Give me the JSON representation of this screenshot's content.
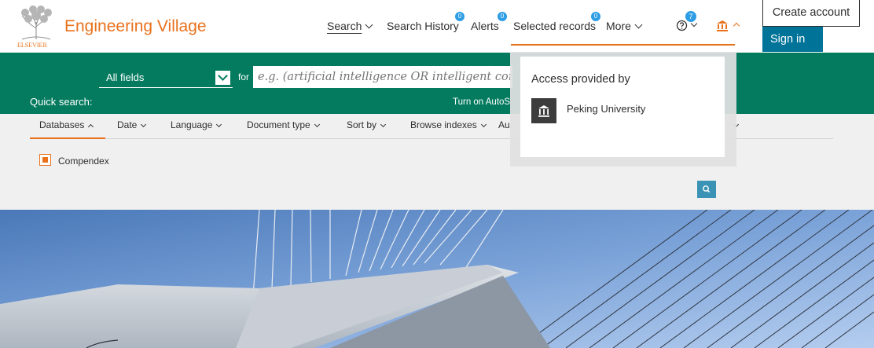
{
  "header": {
    "brand": "Engineering Village",
    "logo_caption": "ELSEVIER",
    "nav": {
      "search": "Search",
      "search_history": "Search History",
      "search_history_count": "0",
      "alerts": "Alerts",
      "alerts_count": "0",
      "selected_records": "Selected records",
      "selected_records_count": "0",
      "more": "More"
    },
    "help_count": "7",
    "create_account": "Create account",
    "sign_in": "Sign in"
  },
  "quick_search": {
    "label": "Quick search:",
    "field_value": "All fields",
    "for_label": "for",
    "placeholder": "e.g. (artificial intelligence OR intelligent comput",
    "autosuggest_text": "Turn on AutoS"
  },
  "filters": {
    "items": [
      "Databases",
      "Date",
      "Language",
      "Document type",
      "Sort by",
      "Browse indexes",
      "Au"
    ],
    "database_checkbox": "Compendex"
  },
  "institution_dropdown": {
    "title": "Access provided by",
    "institution": "Peking University"
  },
  "colors": {
    "brand_orange": "#e9711c",
    "search_band_green": "#047b5f",
    "sign_in_blue": "#007398",
    "badge_blue": "#2d9de5"
  },
  "icons": [
    "elsevier-tree-logo",
    "help-icon",
    "institution-icon",
    "search-icon",
    "chevron-down-icon"
  ]
}
